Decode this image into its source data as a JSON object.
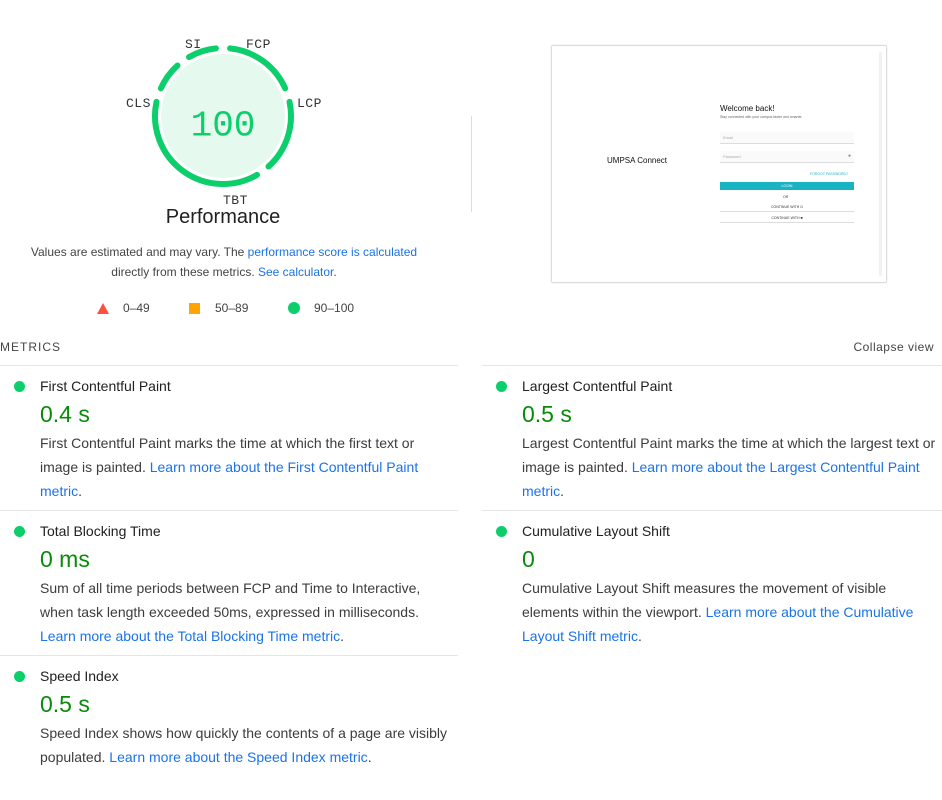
{
  "gauge": {
    "score": "100",
    "score_fraction": 1.0,
    "labels": {
      "si": "SI",
      "fcp": "FCP",
      "lcp": "LCP",
      "cls": "CLS",
      "tbt": "TBT"
    },
    "title": "Performance",
    "color": "#0cce6b"
  },
  "note": {
    "text1": "Values are estimated and may vary. The ",
    "link1": "performance score is calculated",
    "text2": " directly from these metrics. ",
    "link2": "See calculator",
    "text3": "."
  },
  "legend": [
    {
      "range": "0–49",
      "shape": "triangle",
      "color": "#ff4e42"
    },
    {
      "range": "50–89",
      "shape": "square",
      "color": "#ffa400"
    },
    {
      "range": "90–100",
      "shape": "circle",
      "color": "#0cce6b"
    }
  ],
  "screenshot": {
    "brand": "UMPSA Connect",
    "welcome": "Welcome back!",
    "subtitle": "Stay connected with your campus faster and smarter.",
    "email_placeholder": "Email",
    "password_placeholder": "Password",
    "forgot": "FORGOT PASSWORD?",
    "login": "LOGIN",
    "or": "OR",
    "continue_google": "CONTINUE WITH",
    "continue_microsoft": "CONTINUE WITH"
  },
  "metrics_header": "METRICS",
  "collapse_label": "Collapse view",
  "metrics": {
    "fcp": {
      "title": "First Contentful Paint",
      "value": "0.4 s",
      "desc": "First Contentful Paint marks the time at which the first text or image is painted. ",
      "link": "Learn more about the First Contentful Paint metric",
      "end": "."
    },
    "lcp": {
      "title": "Largest Contentful Paint",
      "value": "0.5 s",
      "desc": "Largest Contentful Paint marks the time at which the largest text or image is painted. ",
      "link": "Learn more about the Largest Contentful Paint metric",
      "end": "."
    },
    "tbt": {
      "title": "Total Blocking Time",
      "value": "0 ms",
      "desc": "Sum of all time periods between FCP and Time to Interactive, when task length exceeded 50ms, expressed in milliseconds. ",
      "link": "Learn more about the Total Blocking Time metric",
      "end": "."
    },
    "cls": {
      "title": "Cumulative Layout Shift",
      "value": "0",
      "desc": "Cumulative Layout Shift measures the movement of visible elements within the viewport. ",
      "link": "Learn more about the Cumulative Layout Shift metric",
      "end": "."
    },
    "si": {
      "title": "Speed Index",
      "value": "0.5 s",
      "desc": "Speed Index shows how quickly the contents of a page are visibly populated. ",
      "link": "Learn more about the Speed Index metric",
      "end": "."
    }
  }
}
